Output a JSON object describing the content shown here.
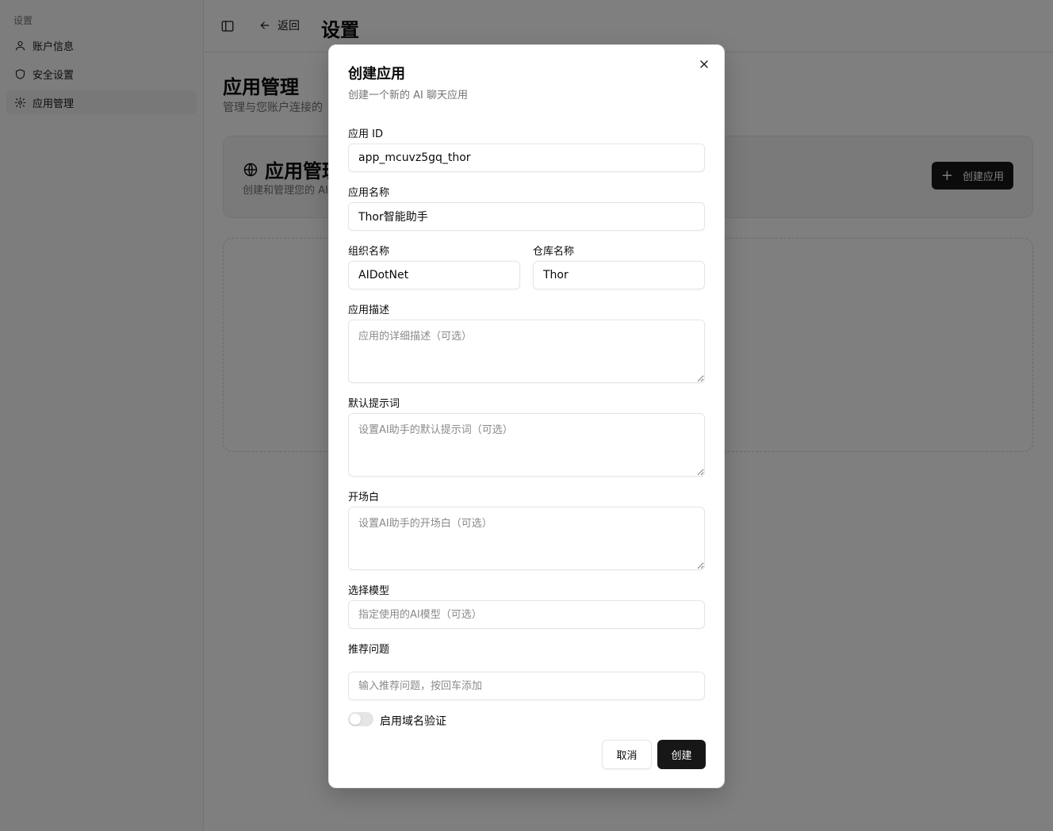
{
  "sidebar": {
    "group_label": "设置",
    "items": [
      {
        "label": "账户信息",
        "icon": "user-icon"
      },
      {
        "label": "安全设置",
        "icon": "shield-icon"
      },
      {
        "label": "应用管理",
        "icon": "gear-icon",
        "active": true
      }
    ]
  },
  "header": {
    "back_label": "返回",
    "title": "设置"
  },
  "content": {
    "title": "应用管理",
    "subtitle": "管理与您账户连接的",
    "card": {
      "title": "应用管理",
      "subtitle": "创建和管理您的 AI",
      "create_button": "创建应用"
    }
  },
  "modal": {
    "title": "创建应用",
    "description": "创建一个新的 AI 聊天应用",
    "fields": {
      "app_id": {
        "label": "应用 ID",
        "value": "app_mcuvz5gq_thor"
      },
      "app_name": {
        "label": "应用名称",
        "value": "Thor智能助手"
      },
      "org_name": {
        "label": "组织名称",
        "value": "AIDotNet"
      },
      "repo_name": {
        "label": "仓库名称",
        "value": "Thor"
      },
      "description": {
        "label": "应用描述",
        "placeholder": "应用的详细描述（可选）"
      },
      "default_prompt": {
        "label": "默认提示词",
        "placeholder": "设置AI助手的默认提示词（可选）"
      },
      "opening": {
        "label": "开场白",
        "placeholder": "设置AI助手的开场白（可选）"
      },
      "model": {
        "label": "选择模型",
        "placeholder": "指定使用的AI模型（可选）"
      },
      "questions": {
        "label": "推荐问题",
        "placeholder": "输入推荐问题，按回车添加"
      }
    },
    "domain_verify": {
      "label": "启用域名验证",
      "enabled": false
    },
    "cancel_label": "取消",
    "create_label": "创建"
  },
  "colors": {
    "primary": "#171717",
    "overlay": "rgba(0,0,0,0.5)",
    "muted_text": "#737373",
    "border": "#e5e5e5"
  }
}
